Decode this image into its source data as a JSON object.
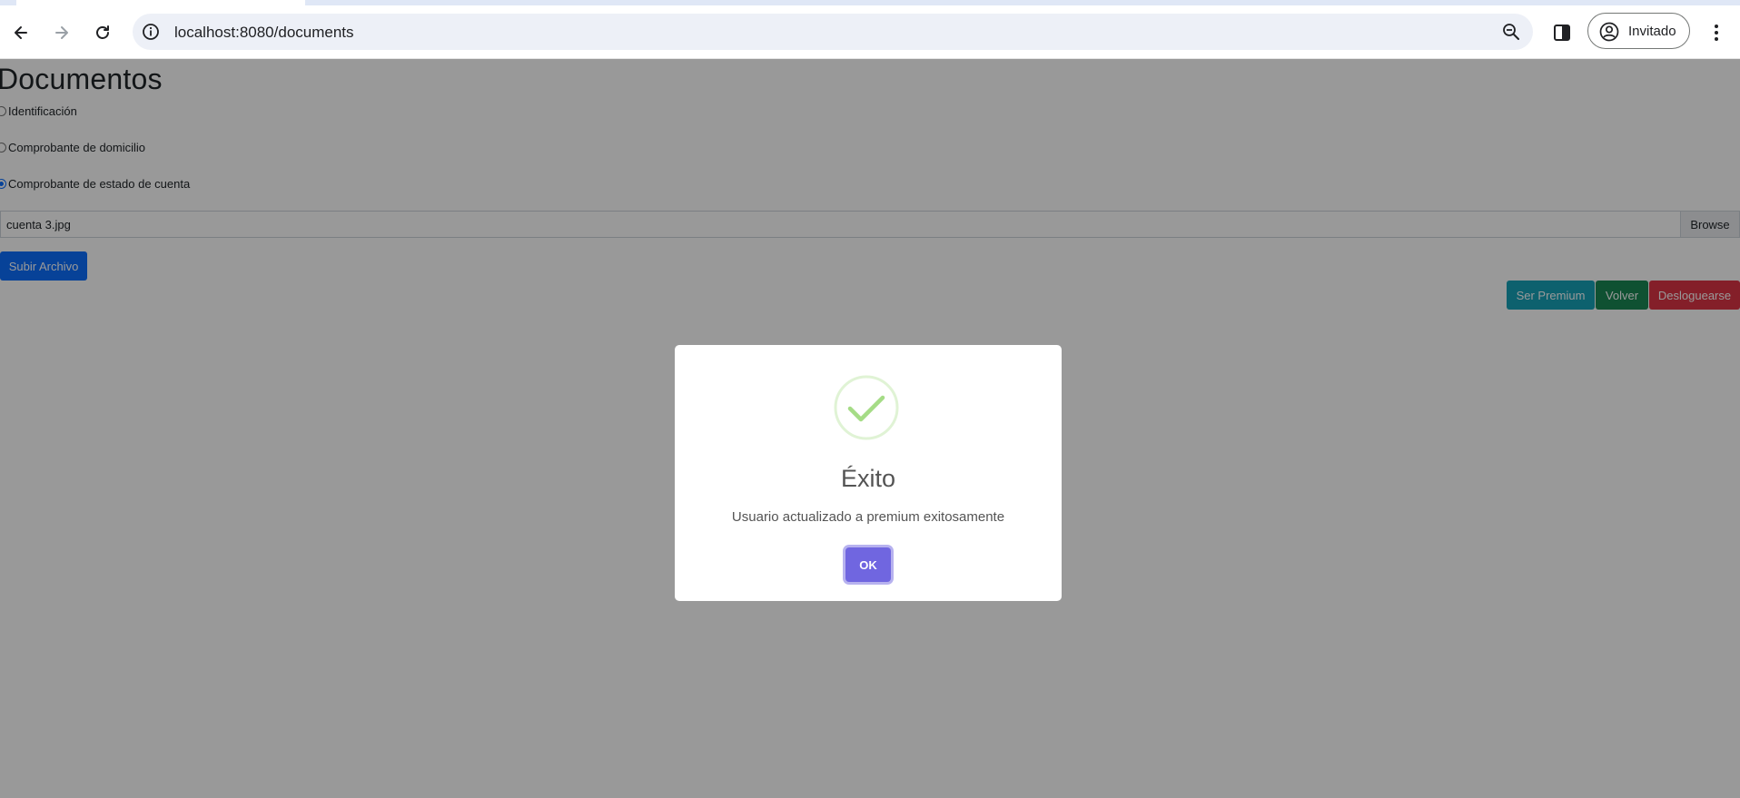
{
  "browser": {
    "url": "localhost:8080/documents",
    "profile_label": "Invitado",
    "icons": {
      "back": "arrow-left-icon",
      "forward": "arrow-right-icon",
      "reload": "reload-icon",
      "site_info": "info-icon",
      "zoom": "zoom-out-icon",
      "side_panel": "side-panel-icon",
      "profile": "person-circle-icon",
      "menu": "kebab-menu-icon"
    }
  },
  "page": {
    "title": "Documentos",
    "document_types": [
      {
        "label": "Identificación",
        "checked": false
      },
      {
        "label": "Comprobante de domicilio",
        "checked": false
      },
      {
        "label": "Comprobante de estado de cuenta",
        "checked": true
      }
    ],
    "file_input": {
      "file_name": "cuenta 3.jpg",
      "browse_label": "Browse"
    },
    "upload_label": "Subir Archivo",
    "actions": {
      "premium_label": "Ser Premium",
      "back_label": "Volver",
      "logout_label": "Desloguearse"
    }
  },
  "modal": {
    "icon": "success-check-icon",
    "title": "Éxito",
    "text": "Usuario actualizado a premium exitosamente",
    "confirm_label": "OK"
  },
  "colors": {
    "primary": "#0d6efd",
    "info": "#17a2b8",
    "success": "#198754",
    "danger": "#dc3545",
    "modal_confirm": "#7066e0",
    "success_icon": "#a5dc86"
  }
}
